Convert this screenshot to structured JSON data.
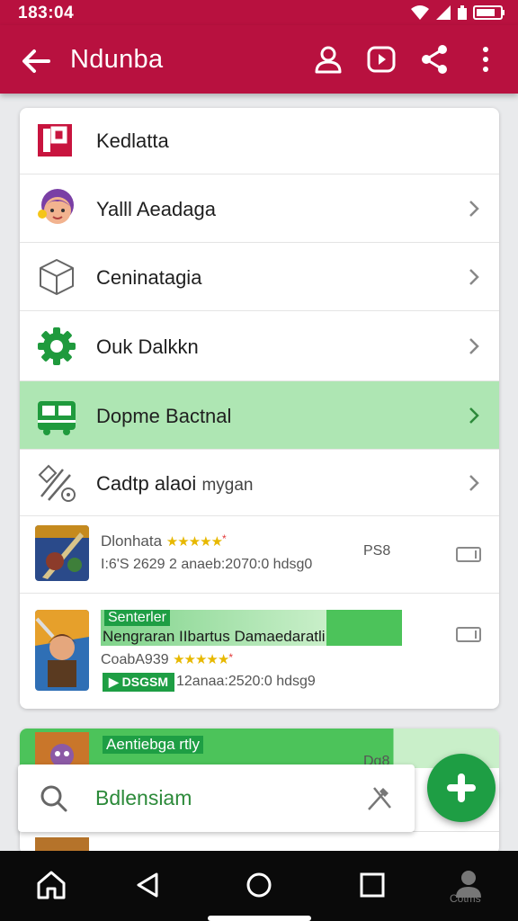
{
  "status_bar": {
    "time": "183:04"
  },
  "app_bar": {
    "title": "Ndunba"
  },
  "menu_items": [
    {
      "label": "Kedlatta",
      "icon": "brand-logo-icon",
      "chevron": false
    },
    {
      "label": "Yalll Aeadaga",
      "icon": "avatar-icon",
      "chevron": true
    },
    {
      "label": "Ceninatagia",
      "icon": "cube-icon",
      "chevron": true
    },
    {
      "label": "Ouk Dalkkn",
      "icon": "gear-icon",
      "chevron": true
    },
    {
      "label": "Dopme Bactnal",
      "icon": "bus-icon",
      "chevron": true
    },
    {
      "label": "Cadtp alaoi",
      "sub": "mygan",
      "icon": "tools-icon",
      "chevron": true
    }
  ],
  "games": [
    {
      "title": "Dlonhata",
      "stars": "★★★★★",
      "meta": "I:6'S 2629  2 anaeb:2070:0 hdsg0",
      "price": "PS8"
    },
    {
      "banner": "Senterler",
      "title": "Nengraran IIbartus Damaedaratli",
      "subtitle": "CoabA939",
      "stars": "★★★★★",
      "button": "▶ DSGSM",
      "meta": "12anaa:2520:0 hdsg9"
    },
    {
      "banner": "Aentiebga rtly",
      "price": "Dg8"
    }
  ],
  "search": {
    "text": "Bdlensiam"
  },
  "nav": {
    "label": "Cotms"
  },
  "colors": {
    "primary": "#b8113f",
    "accent_green": "#1e9e44",
    "highlight": "#aee6b3"
  }
}
